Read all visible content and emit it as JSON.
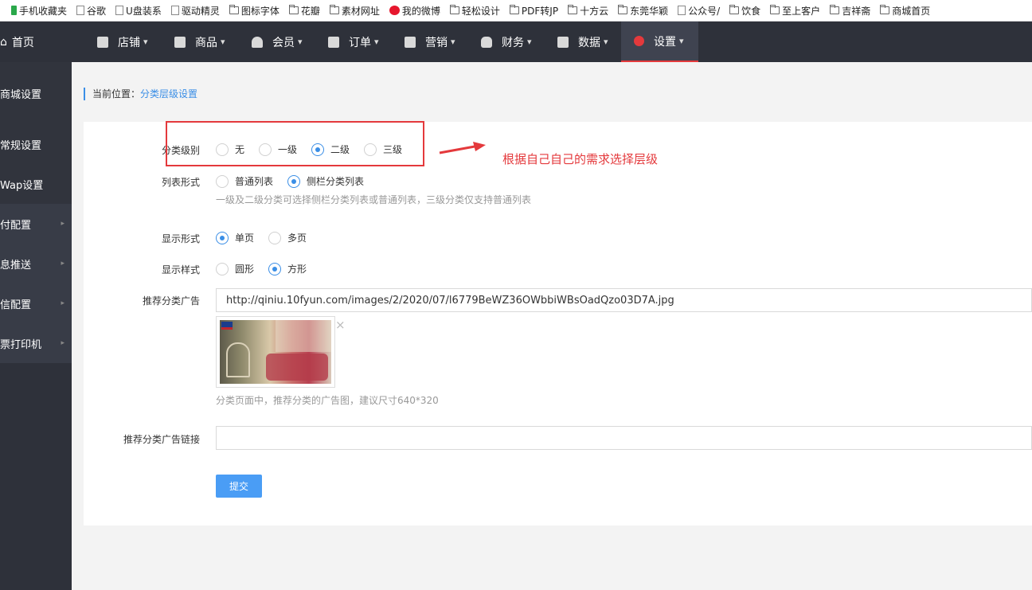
{
  "bookmarks": [
    {
      "label": "手机收藏夹",
      "icon": "phone-icon"
    },
    {
      "label": "谷歌",
      "icon": "page-icon"
    },
    {
      "label": "U盘装系",
      "icon": "page-icon"
    },
    {
      "label": "驱动精灵",
      "icon": "page-icon"
    },
    {
      "label": "图标字体",
      "icon": "folder-icon"
    },
    {
      "label": "花瓣",
      "icon": "folder-icon"
    },
    {
      "label": "素材网址",
      "icon": "folder-icon"
    },
    {
      "label": "我的微博",
      "icon": "weibo-icon"
    },
    {
      "label": "轻松设计",
      "icon": "folder-icon"
    },
    {
      "label": "PDF转JP",
      "icon": "folder-icon"
    },
    {
      "label": "十方云",
      "icon": "folder-icon"
    },
    {
      "label": "东莞华颖",
      "icon": "folder-icon"
    },
    {
      "label": "公众号/",
      "icon": "page-icon"
    },
    {
      "label": "饮食",
      "icon": "folder-icon"
    },
    {
      "label": "至上客户",
      "icon": "folder-icon"
    },
    {
      "label": "吉祥斋",
      "icon": "folder-icon"
    },
    {
      "label": "商城首页",
      "icon": "folder-icon"
    }
  ],
  "topnav": {
    "home": "首页",
    "items": [
      {
        "label": "店铺",
        "icon": "store-icon"
      },
      {
        "label": "商品",
        "icon": "goods-icon"
      },
      {
        "label": "会员",
        "icon": "member-icon"
      },
      {
        "label": "订单",
        "icon": "order-icon"
      },
      {
        "label": "营销",
        "icon": "gift-icon"
      },
      {
        "label": "财务",
        "icon": "money-bag-icon"
      },
      {
        "label": "数据",
        "icon": "chart-icon"
      },
      {
        "label": "设置",
        "icon": "gear-icon",
        "active": true
      }
    ]
  },
  "sidebar": {
    "items": [
      {
        "label": "商城设置"
      },
      {
        "label": "常规设置"
      },
      {
        "label": "Wap设置"
      },
      {
        "label": "付配置",
        "has_arrow": true
      },
      {
        "label": "息推送",
        "has_arrow": true
      },
      {
        "label": "信配置",
        "has_arrow": true
      },
      {
        "label": "票打印机",
        "has_arrow": true
      }
    ]
  },
  "breadcrumb": {
    "prefix": "当前位置：",
    "current": "分类层级设置"
  },
  "form": {
    "category_level": {
      "label": "分类级别",
      "options": [
        "无",
        "一级",
        "二级",
        "三级"
      ],
      "selected": "二级"
    },
    "list_style": {
      "label": "列表形式",
      "options": [
        "普通列表",
        "侧栏分类列表"
      ],
      "selected": "侧栏分类列表",
      "hint": "一级及二级分类可选择侧栏分类列表或普通列表，三级分类仅支持普通列表"
    },
    "display_form": {
      "label": "显示形式",
      "options": [
        "单页",
        "多页"
      ],
      "selected": "单页"
    },
    "display_style": {
      "label": "显示样式",
      "options": [
        "圆形",
        "方形"
      ],
      "selected": "方形"
    },
    "ad": {
      "label": "推荐分类广告",
      "value": "http://qiniu.10fyun.com/images/2/2020/07/l6779BeWZ36OWbbiWBsOadQzo03D7A.jpg",
      "hint": "分类页面中，推荐分类的广告图，建议尺寸640*320",
      "remove": "×"
    },
    "ad_link": {
      "label": "推荐分类广告链接",
      "value": ""
    },
    "submit": "提交"
  },
  "annotation": "根据自己自己的需求选择层级",
  "colors": {
    "accent": "#3a8ee6",
    "nav_bg": "#2e313a",
    "highlight": "#e4393c",
    "button": "#4a9df5"
  }
}
